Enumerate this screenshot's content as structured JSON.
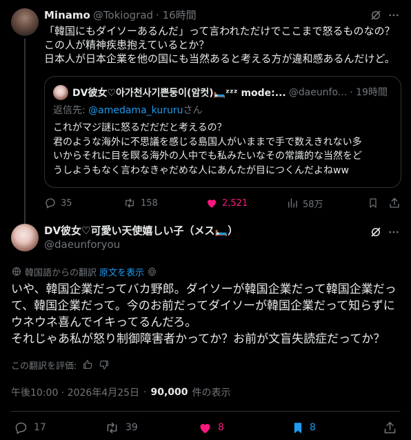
{
  "parent_tweet": {
    "display_name": "Minamo",
    "handle": "@Tokiograd",
    "time": "· 16時間",
    "text_lines": [
      "「韓国にもダイソーあるんだ」って言われただけでここまで怒るものなの？",
      "この人が精神疾患抱えているとか？",
      "日本人が日本企業を他の国にも当然あると考える方が違和感あるんだけど。"
    ],
    "quote": {
      "display_name": "DV彼女♡아가천사기쁜둥이(암컷)🛏️ᶻᶻᶻ mode:...",
      "handle": "@daeunfo...",
      "time": "· 19時間",
      "reply_to_prefix": "返信先: ",
      "reply_to_handle": "@amedama_kururu",
      "reply_to_suffix": "さん",
      "text_lines": [
        "これがマジ謎に怒るだだだと考えるの？",
        "君のような海外に不思議を感じる島国人がいままで手で数えきれない多",
        "いからそれに目を瞑る海外の人中でも私みたいなその常識的な当然をど",
        "うしようもなく言わなきゃだめな人にあんたが目につくんだよねww"
      ]
    },
    "actions": {
      "reply_count": "35",
      "retweet_count": "158",
      "like_count": "2,521",
      "views_count": "58万"
    }
  },
  "main_tweet": {
    "display_name": "DV彼女♡可愛い天使嬉しい子（メス🛏️）",
    "handle": "@daeunforyou",
    "translation_label": "韓国語からの翻訳",
    "show_original_label": "原文を表示",
    "text_lines": [
      "いや、韓国企業だってバカ野郎。ダイソーが韓国企業だって韓国企業だっ",
      "て、韓国企業だって。今のお前だってダイソーが韓国企業だって知らずに",
      "ウネウネ喜んでイキってるんだろ。",
      "それじゃあ私が怒り制御障害者かってか？お前が文盲失読症だってか？"
    ],
    "rate_translation_label": "この翻訳を評価:",
    "timestamp": "午後10:00 · 2026年4月25日",
    "views_value": "90,000",
    "views_label": "件の表示",
    "actions": {
      "reply_count": "17",
      "retweet_count": "39",
      "like_count": "8",
      "bookmark_count": "8"
    }
  },
  "colors": {
    "background": "#000000",
    "text": "#e7e9ea",
    "muted": "#71767b",
    "accent": "#1d9bf0",
    "like": "#f91880",
    "border": "#2f3336"
  },
  "icons": [
    "grok-icon",
    "more-icon",
    "reply-icon",
    "retweet-icon",
    "like-icon",
    "views-icon",
    "bookmark-icon",
    "share-icon",
    "translate-icon",
    "settings-icon",
    "thumbs-up-icon",
    "thumbs-down-icon"
  ]
}
